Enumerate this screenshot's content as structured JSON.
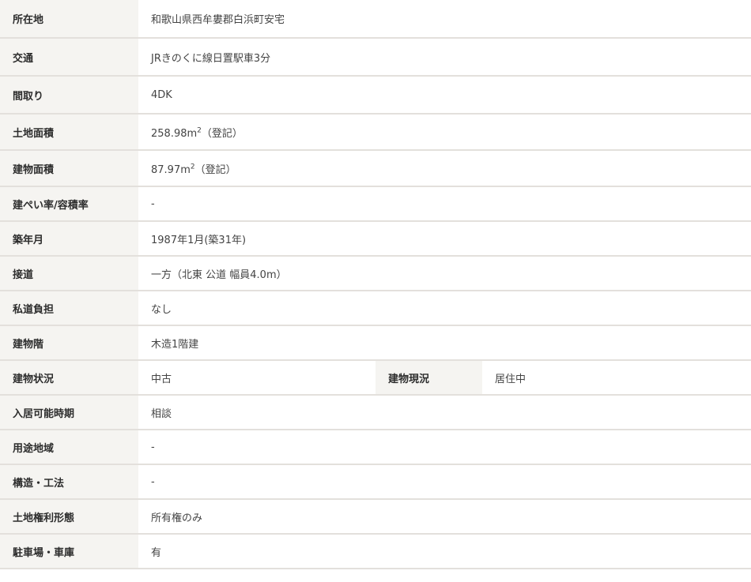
{
  "rows": [
    {
      "label": "所在地",
      "value": "和歌山県西牟婁郡白浜町安宅"
    },
    {
      "label": "交通",
      "value": "JRきのくに線日置駅車3分"
    },
    {
      "label": "間取り",
      "value": "4DK"
    },
    {
      "label": "土地面積",
      "value": "258.98m",
      "sup": "2",
      "note": "（登記）"
    },
    {
      "label": "建物面積",
      "value": "87.97m",
      "sup": "2",
      "note": "（登記）"
    },
    {
      "label": "建ぺい率/容積率",
      "value": "-"
    },
    {
      "label": "築年月",
      "value": "1987年1月(築31年)"
    },
    {
      "label": "接道",
      "value": "一方（北東 公道 幅員4.0m）"
    },
    {
      "label": "私道負担",
      "value": "なし"
    },
    {
      "label": "建物階",
      "value": "木造1階建"
    },
    {
      "label": "建物状況",
      "value": "中古",
      "label2": "建物現況",
      "value2": "居住中"
    },
    {
      "label": "入居可能時期",
      "value": "相談"
    },
    {
      "label": "用途地域",
      "value": "-"
    },
    {
      "label": "構造・工法",
      "value": "-"
    },
    {
      "label": "土地権利形態",
      "value": "所有権のみ"
    },
    {
      "label": "駐車場・車庫",
      "value": "有"
    }
  ]
}
